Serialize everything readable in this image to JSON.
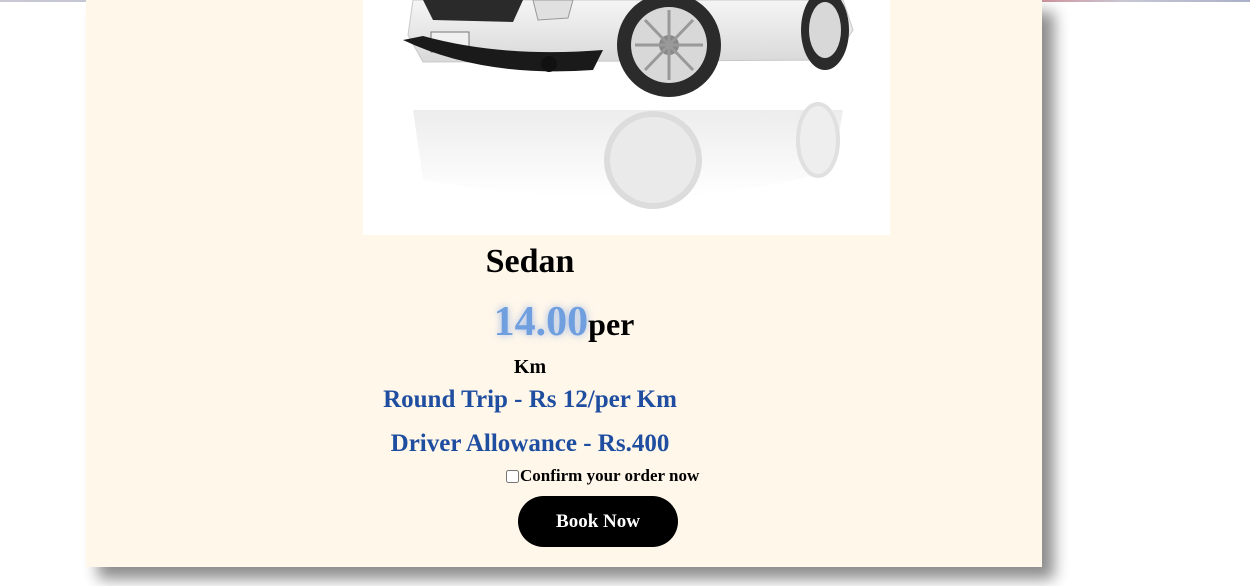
{
  "card": {
    "title": "Sedan",
    "price_value": "14.00",
    "price_unit": "per",
    "price_unit_2": "Km",
    "round_trip": "Round Trip - Rs 12/per Km",
    "driver_allowance": "Driver Allowance - Rs.400",
    "confirm_label": "Confirm your order now",
    "confirm_checked": false,
    "book_button": "Book Now"
  },
  "colors": {
    "card_background": "#fff7ea",
    "info_text": "#1f4ea0",
    "price_text": "#6f9fdf",
    "button": "#000000"
  },
  "icons": {
    "car_image": "white-sedan-car-image"
  }
}
